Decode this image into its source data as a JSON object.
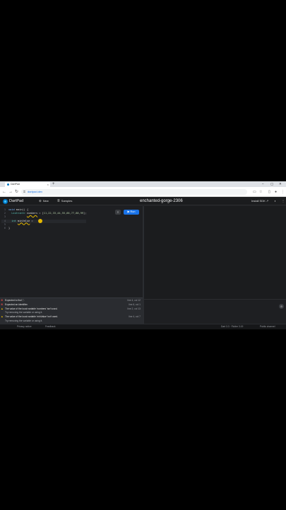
{
  "browser": {
    "tab_title": "DartPad",
    "new_tab": "+",
    "url": "dartpad.dev",
    "window_controls": [
      "–",
      "▢",
      "✕"
    ]
  },
  "header": {
    "app_title": "DartPad",
    "new_label": "New",
    "samples_label": "Samples",
    "project_name": "enchanted-gorge-2306",
    "install_label": "Install SDK"
  },
  "editor": {
    "run_label": "Run",
    "issues_label": "4 issues",
    "lines": [
      {
        "n": "1",
        "parts": [
          [
            "kw",
            "void "
          ],
          [
            "pl",
            "main() {"
          ]
        ]
      },
      {
        "n": "2",
        "parts": [
          [
            "ty",
            "  List<int> "
          ],
          [
            "var",
            "numbers"
          ],
          [
            "pl",
            " = ["
          ],
          [
            "num",
            "11,22,33,44,55,66,77,88,99"
          ],
          [
            "pl",
            "];"
          ]
        ]
      },
      {
        "n": "3",
        "parts": [
          [
            "pl",
            ""
          ]
        ]
      },
      {
        "n": "4",
        "parts": [
          [
            "ty",
            "  int "
          ],
          [
            "var",
            "minValue"
          ],
          [
            "pl",
            " ="
          ]
        ]
      },
      {
        "n": "5",
        "parts": [
          [
            "pl",
            ""
          ]
        ]
      },
      {
        "n": "6",
        "parts": [
          [
            "pl",
            "}"
          ]
        ]
      }
    ]
  },
  "problems": [
    {
      "type": "error",
      "text": "Expected to find ';'.",
      "loc": "line 4, col 12"
    },
    {
      "type": "error",
      "text": "Expected an identifier.",
      "loc": "line 6, col 1"
    },
    {
      "type": "warning",
      "text": "The value of the local variable 'numbers' isn't used.",
      "loc": "line 2, col 13"
    },
    {
      "type": "sub",
      "text": "Try removing the variable or using it.",
      "loc": ""
    },
    {
      "type": "warning",
      "text": "The value of the local variable 'minValue' isn't used.",
      "loc": "line 4, col 7"
    },
    {
      "type": "sub",
      "text": "Try removing the variable or using it.",
      "loc": ""
    }
  ],
  "footer": {
    "left": "Privacy notice",
    "mid": "Feedback",
    "version": "Dart 3.3 · Flutter 3.19",
    "right": "Public channel"
  },
  "colors": {
    "accent": "#1a73e8",
    "brand": "#0175c2",
    "error": "#f14c4c",
    "warning": "#e6b800"
  }
}
